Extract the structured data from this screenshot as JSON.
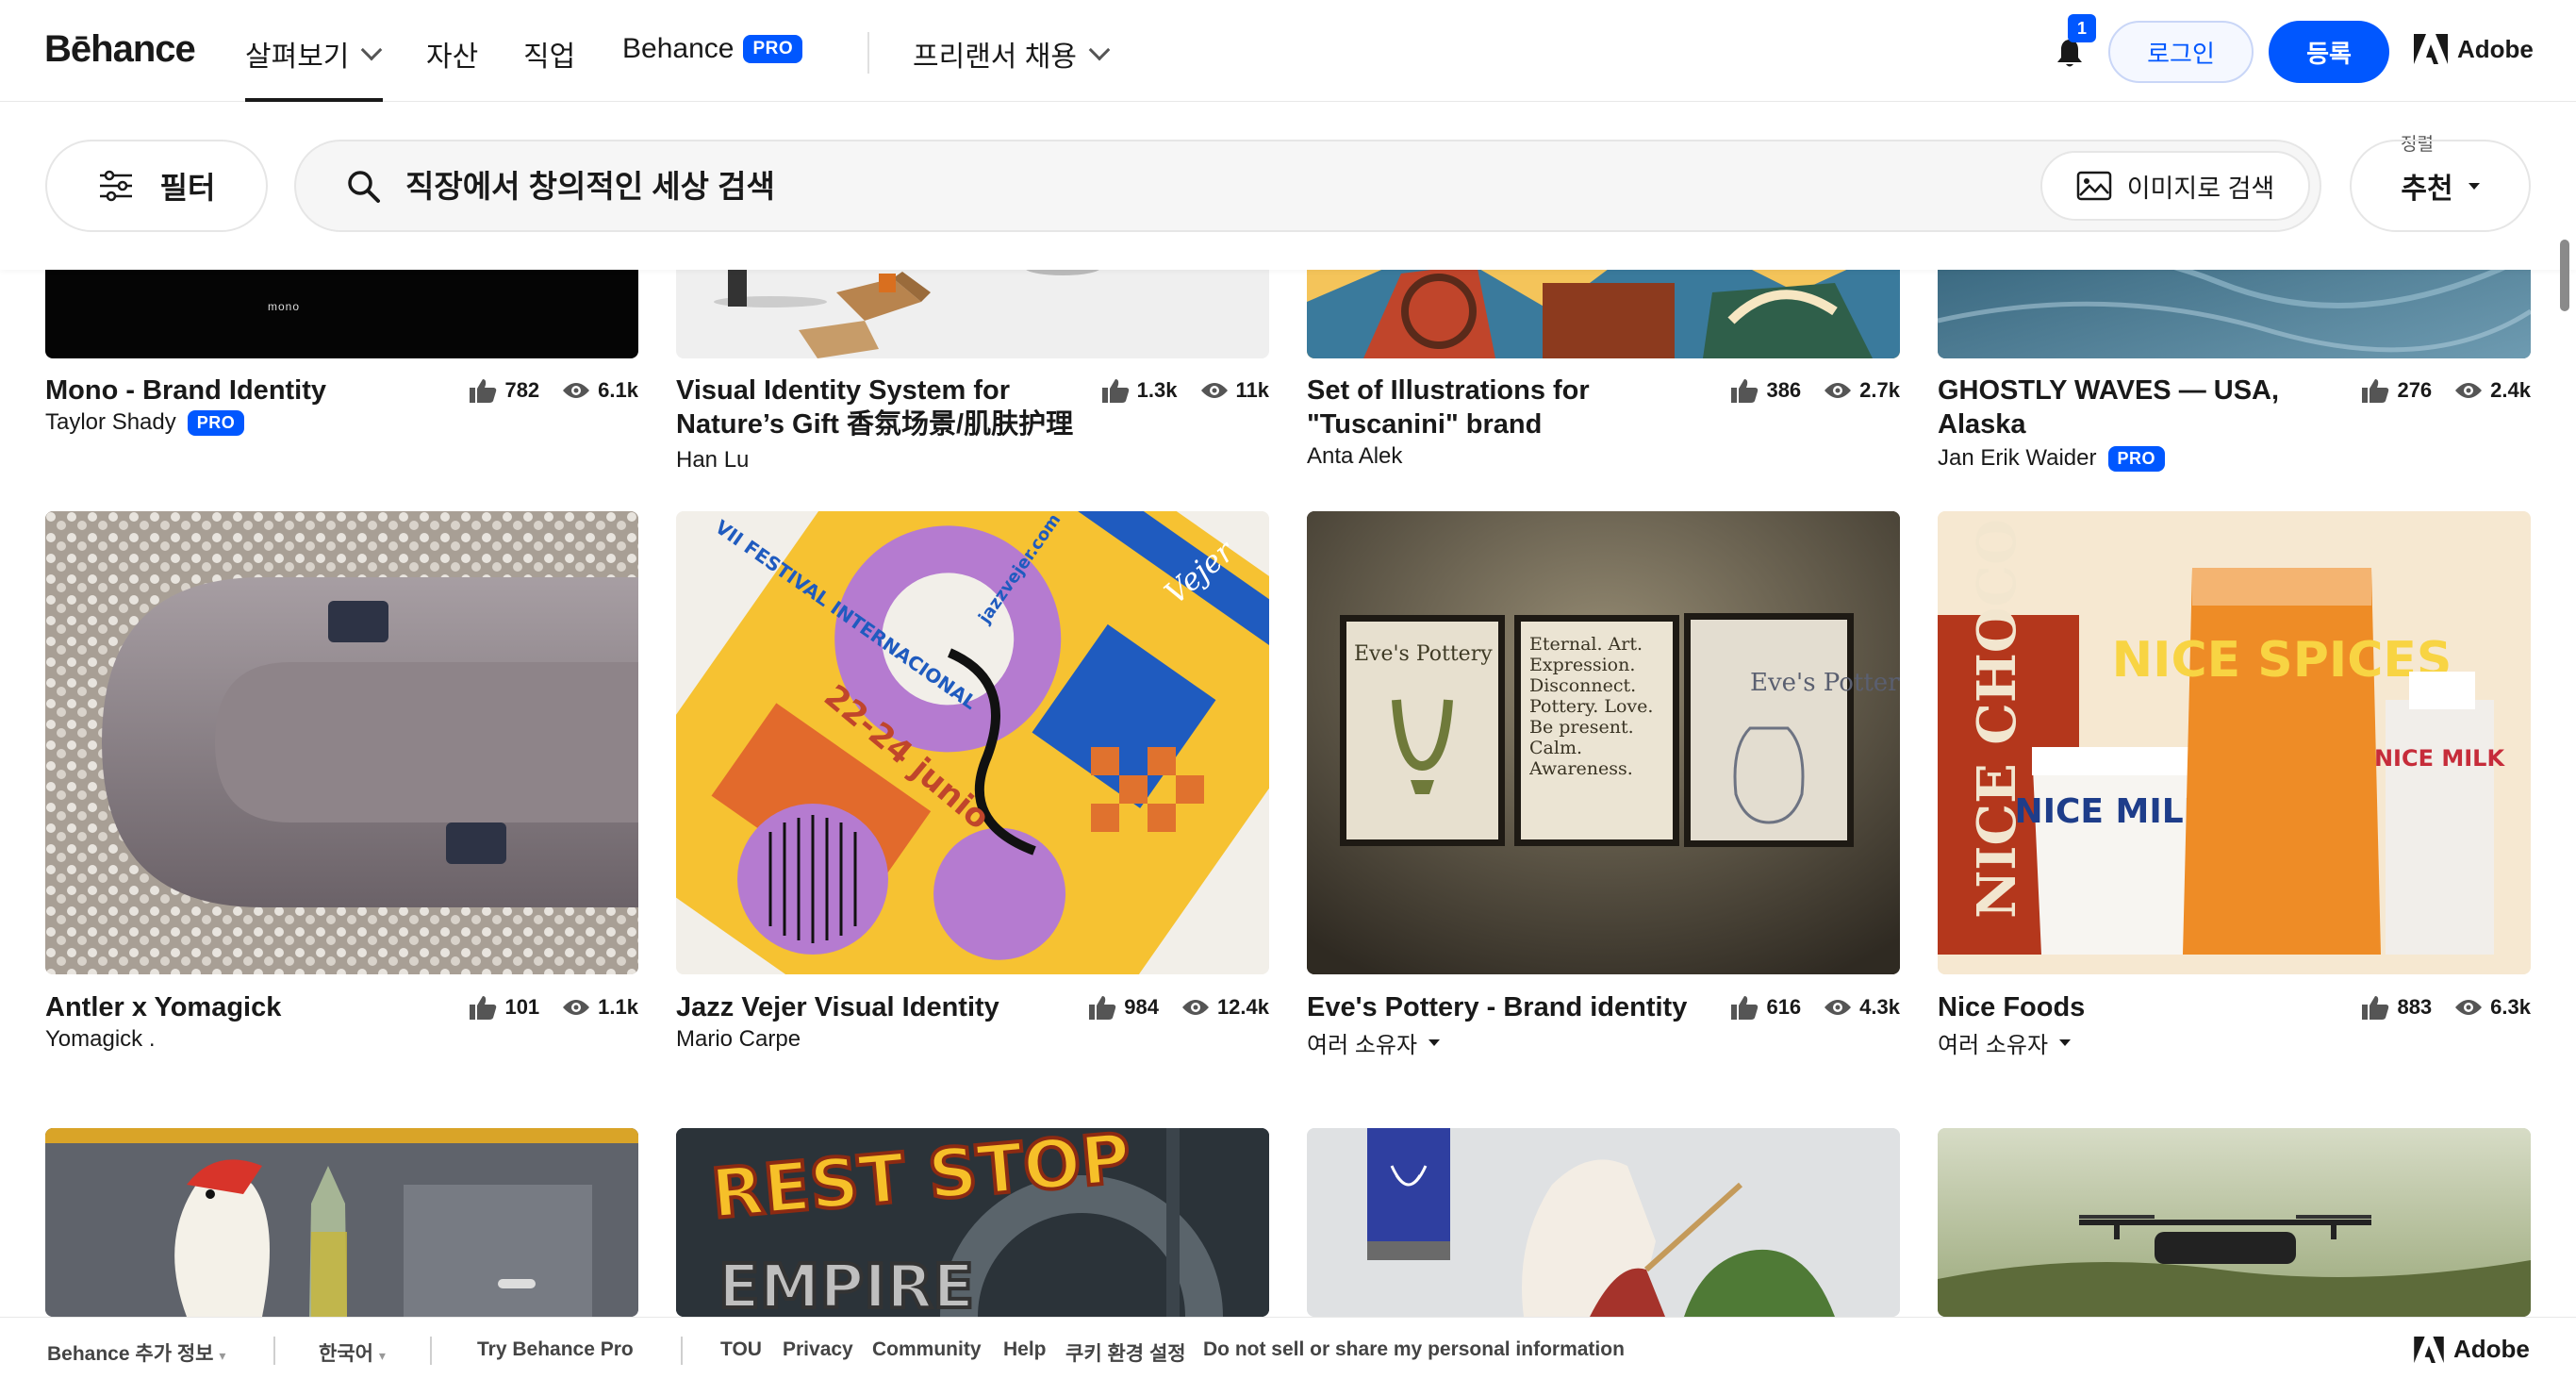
{
  "nav": {
    "logo": "Bēhance",
    "explore": "살펴보기",
    "assets": "자산",
    "jobs": "직업",
    "behance": "Behance",
    "pro": "PRO",
    "hire": "프리랜서 채용",
    "notification_count": "1",
    "login": "로그인",
    "signup": "등록",
    "adobe": "Adobe"
  },
  "filterbar": {
    "filter": "필터",
    "search_placeholder": "직장에서 창의적인 세상 검색",
    "image_search": "이미지로 검색",
    "sort_label": "정렬",
    "sort_value": "추천"
  },
  "projects": [
    {
      "title": "Mono - Brand Identity",
      "owner": "Taylor Shady",
      "pro": "PRO",
      "likes": "782",
      "views": "6.1k"
    },
    {
      "title": "Visual Identity System for Nature’s Gift 香氛场景/肌肤护理",
      "owner": "Han Lu",
      "pro": "",
      "likes": "1.3k",
      "views": "11k"
    },
    {
      "title": "Set of Illustrations for \"Tuscanini\" brand",
      "owner": "Anta Alek",
      "pro": "",
      "likes": "386",
      "views": "2.7k"
    },
    {
      "title": "GHOSTLY WAVES — USA, Alaska",
      "owner": "Jan Erik Waider",
      "pro": "PRO",
      "likes": "276",
      "views": "2.4k"
    },
    {
      "title": "Antler x Yomagick",
      "owner": "Yomagick .",
      "pro": "",
      "likes": "101",
      "views": "1.1k"
    },
    {
      "title": "Jazz Vejer Visual Identity",
      "owner": "Mario Carpe",
      "pro": "",
      "likes": "984",
      "views": "12.4k"
    },
    {
      "title": "Eve's Pottery - Brand identity",
      "owner": "여러 소유자",
      "pro": "",
      "likes": "616",
      "views": "4.3k"
    },
    {
      "title": "Nice Foods",
      "owner": "여러 소유자",
      "pro": "",
      "likes": "883",
      "views": "6.3k"
    }
  ],
  "thumb_text": {
    "mono": "mono",
    "jazz_date": "22-24 junio",
    "jazz_site": "jazzvejer.com",
    "jazz_fest": "VII FESTIVAL INTERNACIONAL",
    "jazz_word": "Vejer",
    "eve1": "Eve's Pottery",
    "eve2": "Eternal. Art. Expression. Disconnect. Pottery. Love. Be present. Calm. Awareness.",
    "eve3": "Eve's Pottery",
    "nice_choco": "NICE CHOCO",
    "nice_milk": "NICE MILK",
    "nice_spices": "NICE SPICES",
    "nice_milk2": "NICE MILK",
    "rest_stop": "REST STOP",
    "empire": "EMPIRE"
  },
  "footer": {
    "more": "Behance 추가 정보",
    "lang": "한국어",
    "try_pro": "Try Behance Pro",
    "tou": "TOU",
    "privacy": "Privacy",
    "community": "Community",
    "help": "Help",
    "cookie": "쿠키 환경 설정",
    "dnsmpi": "Do not sell or share my personal information",
    "adobe": "Adobe"
  },
  "colors": {
    "accent": "#0057ff",
    "text": "#191919"
  },
  "icons": [
    "chevron-down-icon",
    "bell-icon",
    "adobe-logo-icon",
    "filter-sliders-icon",
    "search-icon",
    "image-icon",
    "thumbs-up-icon",
    "eye-icon"
  ]
}
